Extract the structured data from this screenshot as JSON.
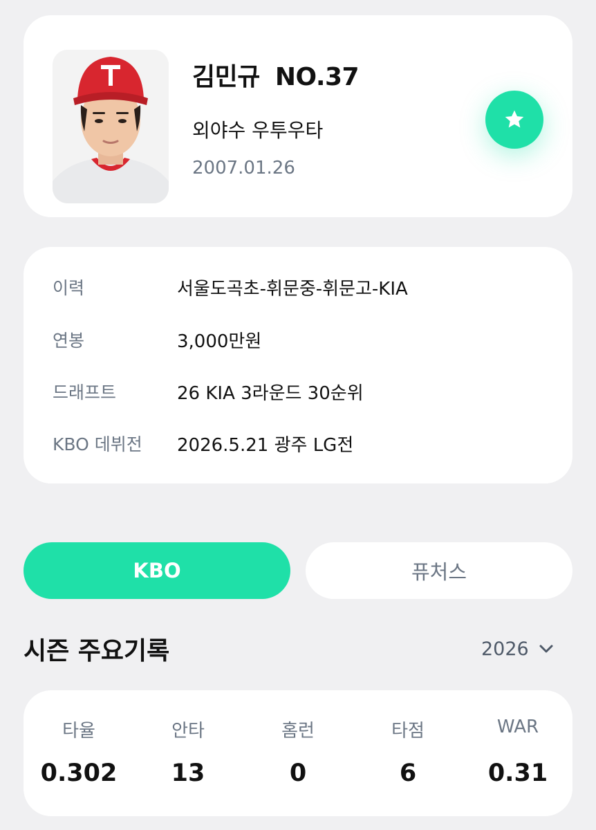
{
  "player": {
    "name": "김민규",
    "number": "NO.37",
    "position": "외야수 우투우타",
    "birthdate": "2007.01.26"
  },
  "favorite": {
    "icon": "star-icon"
  },
  "info": [
    {
      "label": "이력",
      "value": "서울도곡초-휘문중-휘문고-KIA"
    },
    {
      "label": "연봉",
      "value": "3,000만원"
    },
    {
      "label": "드래프트",
      "value": "26 KIA 3라운드 30순위"
    },
    {
      "label": "KBO 데뷔전",
      "value": "2026.5.21 광주 LG전"
    }
  ],
  "tabs": [
    {
      "label": "KBO",
      "active": true
    },
    {
      "label": "퓨처스",
      "active": false
    }
  ],
  "section": {
    "title": "시즌 주요기록",
    "year": "2026"
  },
  "stats": [
    {
      "label": "타율",
      "value": "0.302"
    },
    {
      "label": "안타",
      "value": "13"
    },
    {
      "label": "홈런",
      "value": "0"
    },
    {
      "label": "타점",
      "value": "6"
    },
    {
      "label": "WAR",
      "value": "0.31"
    }
  ],
  "colors": {
    "accent": "#1fe0a8",
    "background": "#f0f0f2",
    "card": "#ffffff",
    "muted_text": "#6b7684"
  }
}
